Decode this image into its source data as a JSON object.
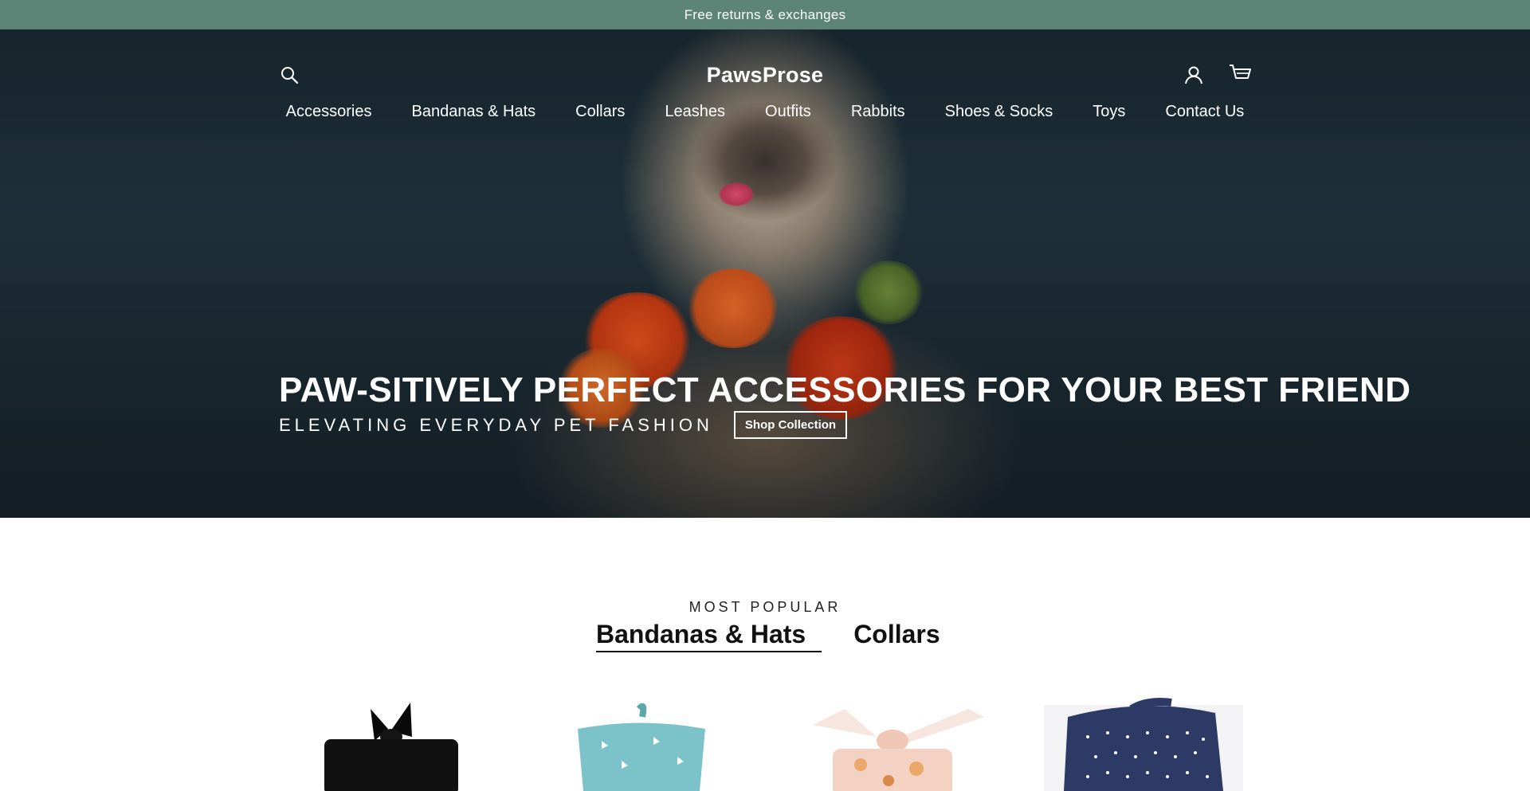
{
  "announcement": {
    "text": "Free returns & exchanges",
    "background": "#5c8577"
  },
  "header": {
    "logo": "PawsProse",
    "icons": {
      "search": "search-icon",
      "account": "account-icon",
      "cart": "cart-icon"
    }
  },
  "nav": {
    "items": [
      {
        "label": "Accessories"
      },
      {
        "label": "Bandanas & Hats"
      },
      {
        "label": "Collars"
      },
      {
        "label": "Leashes"
      },
      {
        "label": "Outfits"
      },
      {
        "label": "Rabbits"
      },
      {
        "label": "Shoes & Socks"
      },
      {
        "label": "Toys"
      },
      {
        "label": "Contact Us"
      }
    ]
  },
  "hero": {
    "title": "PAW-SITIVELY PERFECT ACCESSORIES FOR YOUR BEST FRIEND",
    "subtitle": "ELEVATING EVERYDAY PET FASHION",
    "cta": "Shop Collection"
  },
  "popular": {
    "kicker": "MOST POPULAR",
    "tabs": [
      {
        "label": "Bandanas & Hats",
        "active": true
      },
      {
        "label": "Collars",
        "active": false
      }
    ]
  },
  "products": [
    {
      "name": "black-bow-headband-image",
      "color": "#111111"
    },
    {
      "name": "teal-bandana-image",
      "color": "#7cc3c9"
    },
    {
      "name": "floral-bow-bandana-image",
      "color": "#f3d2c4"
    },
    {
      "name": "navy-star-bandana-image",
      "color": "#2d3a66"
    }
  ]
}
